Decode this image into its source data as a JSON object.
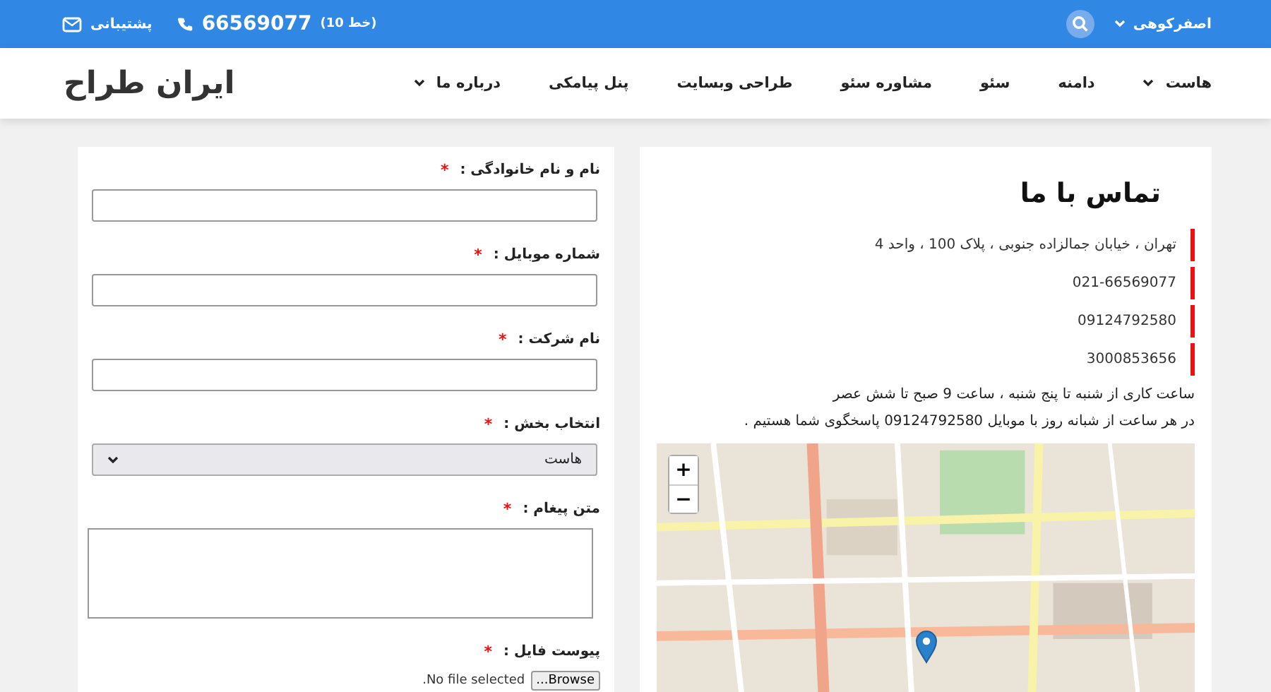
{
  "topbar": {
    "user": "اصفرکوهی",
    "phone": "66569077",
    "phone_lines": "(10 خط)",
    "support": "پشتیبانی"
  },
  "logo": "ایران طراح",
  "nav": [
    {
      "label": "هاست",
      "dropdown": true
    },
    {
      "label": "دامنه",
      "dropdown": false
    },
    {
      "label": "سئو",
      "dropdown": false
    },
    {
      "label": "مشاوره سئو",
      "dropdown": false
    },
    {
      "label": "طراحی وبسایت",
      "dropdown": false
    },
    {
      "label": "پنل پیامکی",
      "dropdown": false
    },
    {
      "label": "درباره ما",
      "dropdown": true
    }
  ],
  "contact": {
    "title": "تماس با ما",
    "details": [
      "تهران ، خیابان جمالزاده جنوبی ، پلاک 100 ، واحد 4",
      "021-66569077",
      "09124792580",
      "3000853656"
    ],
    "notes": [
      "ساعت کاری از شنبه تا پنج شنبه ، ساعت 9 صبح تا شش عصر",
      "در هر ساعت از شبانه روز با موبایل 09124792580 پاسخگوی شما هستیم ."
    ],
    "map": {
      "zoom_in": "+",
      "zoom_out": "−"
    }
  },
  "form": {
    "fields": [
      {
        "kind": "text",
        "label": "نام و نام خانوادگی :",
        "required_mark": "*"
      },
      {
        "kind": "text",
        "label": "شماره موبایل :",
        "required_mark": "*"
      },
      {
        "kind": "text",
        "label": "نام شرکت :",
        "required_mark": "*"
      },
      {
        "kind": "select",
        "label": "انتخاب بخش :",
        "required_mark": "*",
        "value": "هاست"
      },
      {
        "kind": "textarea",
        "label": "متن پیغام :",
        "required_mark": "*"
      },
      {
        "kind": "file",
        "label": "پیوست فایل :",
        "required_mark": "*",
        "button": "Browse...",
        "status": "No file selected."
      }
    ]
  }
}
